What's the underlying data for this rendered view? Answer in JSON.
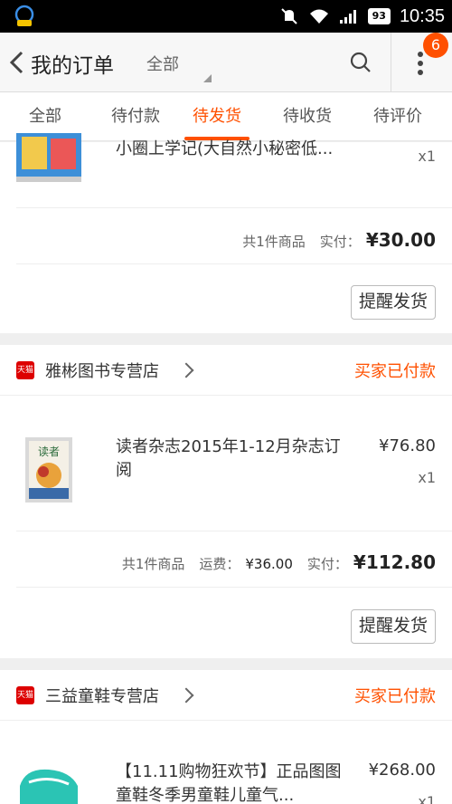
{
  "status_bar": {
    "time": "10:35",
    "battery": "93"
  },
  "header": {
    "title": "我的订单",
    "filter": "全部",
    "badge": "6"
  },
  "tabs": [
    "全部",
    "待付款",
    "待发货",
    "待收货",
    "待评价"
  ],
  "orders": [
    {
      "item_title": "小圈上学记(大自然小秘密低...",
      "qty": "x1",
      "summary": {
        "count": "共1件商品",
        "paid_label": "实付：",
        "paid": "¥30.00"
      },
      "button": "提醒发货"
    },
    {
      "store": "雅彬图书专营店",
      "tmall": "天猫",
      "status": "买家已付款",
      "item_title": "读者杂志2015年1-12月杂志订阅",
      "price": "¥76.80",
      "qty": "x1",
      "summary": {
        "count": "共1件商品",
        "shipping_label": "运费：",
        "shipping": "¥36.00",
        "paid_label": "实付：",
        "paid": "¥112.80"
      },
      "button": "提醒发货"
    },
    {
      "store": "三益童鞋专营店",
      "tmall": "天猫",
      "status": "买家已付款",
      "item_title": "【11.11购物狂欢节】正品图图童鞋冬季男童鞋儿童气...",
      "price": "¥268.00",
      "qty": "x1"
    }
  ]
}
